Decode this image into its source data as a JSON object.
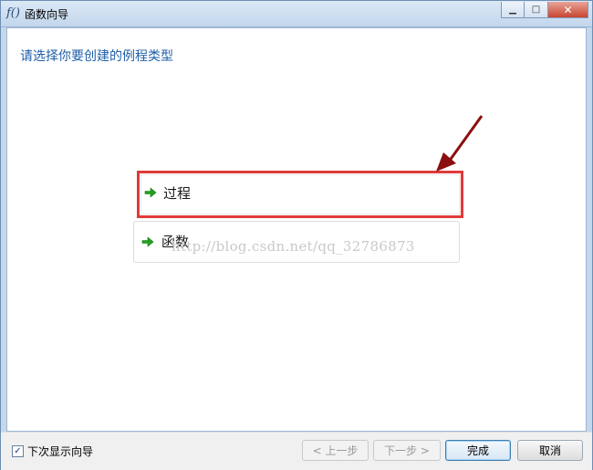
{
  "window": {
    "title": "函数向导",
    "icon_glyph": "f()"
  },
  "main": {
    "heading": "请选择你要创建的例程类型",
    "options": [
      {
        "label": "过程",
        "highlighted": true
      },
      {
        "label": "函数",
        "highlighted": false
      }
    ],
    "watermark": "http://blog.csdn.net/qq_32786873"
  },
  "footer": {
    "show_next_time_label": "下次显示向导",
    "show_next_time_checked": true,
    "prev_label": "< 上一步",
    "next_label": "下一步 >",
    "finish_label": "完成",
    "cancel_label": "取消"
  },
  "colors": {
    "heading": "#1f5fa8",
    "highlight_border": "#e03a3a",
    "annotation_arrow": "#8b0f0f",
    "option_arrow": "#22a01e"
  },
  "icons": {
    "option_icon": "green-right-arrow-icon",
    "annotation": "dark-red-pointer-arrow"
  }
}
